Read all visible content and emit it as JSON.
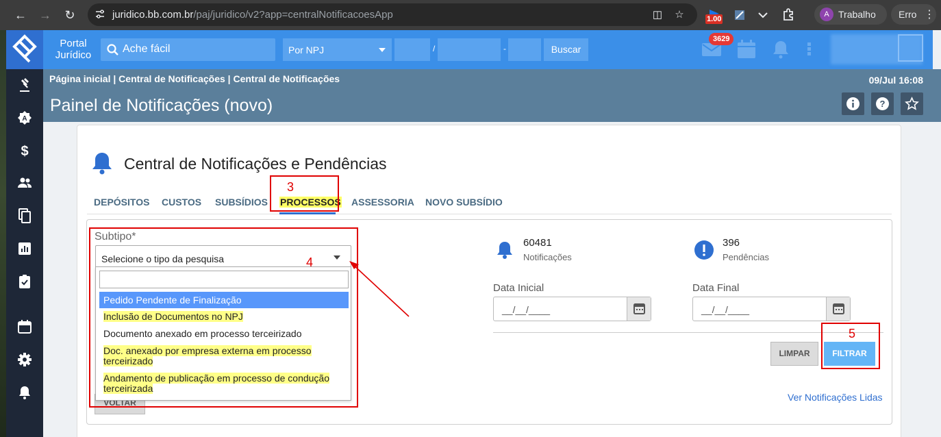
{
  "browser": {
    "url_host": "juridico.bb.com.br",
    "url_path": "/paj/juridico/v2?app=centralNotificacoesApp",
    "extension_badge": "1.00",
    "profile_initial": "A",
    "profile_name": "Trabalho",
    "error_label": "Erro"
  },
  "appbar": {
    "portal_line1": "Portal",
    "portal_line2": "Jurídico",
    "search_placeholder": "Ache fácil",
    "npj_select": "Por NPJ",
    "sep1": "/",
    "sep2": "-",
    "search_button": "Buscar",
    "mail_count": "3629"
  },
  "header": {
    "breadcrumb": "Página inicial | Central de Notificações | Central de Notificações",
    "datetime": "09/Jul 16:08",
    "page_title": "Painel de Notificações (novo)"
  },
  "card": {
    "title": "Central de Notificações e Pendências",
    "tabs": [
      {
        "label": "DEPÓSITOS"
      },
      {
        "label": "CUSTOS"
      },
      {
        "label": "SUBSÍDIOS"
      },
      {
        "label": "PROCESSOS",
        "active": true
      },
      {
        "label": "ASSESSORIA"
      },
      {
        "label": "NOVO SUBSÍDIO"
      }
    ]
  },
  "filters": {
    "subtipo_label": "Subtipo*",
    "subtipo_value": "Selecione o tipo da pesquisa",
    "options": [
      "Pedido Pendente de Finalização",
      "Inclusão de Documentos no NPJ",
      "Documento anexado em processo terceirizado",
      "Doc. anexado por empresa externa em processo terceirizado",
      "Andamento de publicação em processo de condução terceirizada"
    ],
    "data_inicial_label": "Data Inicial",
    "data_final_label": "Data Final",
    "date_placeholder": "__/__/____",
    "limpar": "LIMPAR",
    "filtrar": "FILTRAR",
    "voltar": "VOLTAR",
    "ver_lidas": "Ver Notificações Lidas"
  },
  "stats": {
    "notificacoes_count": "60481",
    "notificacoes_label": "Notificações",
    "pendencias_count": "396",
    "pendencias_label": "Pendências"
  },
  "annotations": {
    "n3": "3",
    "n4": "4",
    "n5": "5"
  },
  "colors": {
    "appbar": "#3b8fe8",
    "header": "#5b7f9b",
    "sidebar": "#1e2737",
    "annotation": "#e00000",
    "highlight": "#ffff66",
    "option_selected": "#5897fb"
  }
}
